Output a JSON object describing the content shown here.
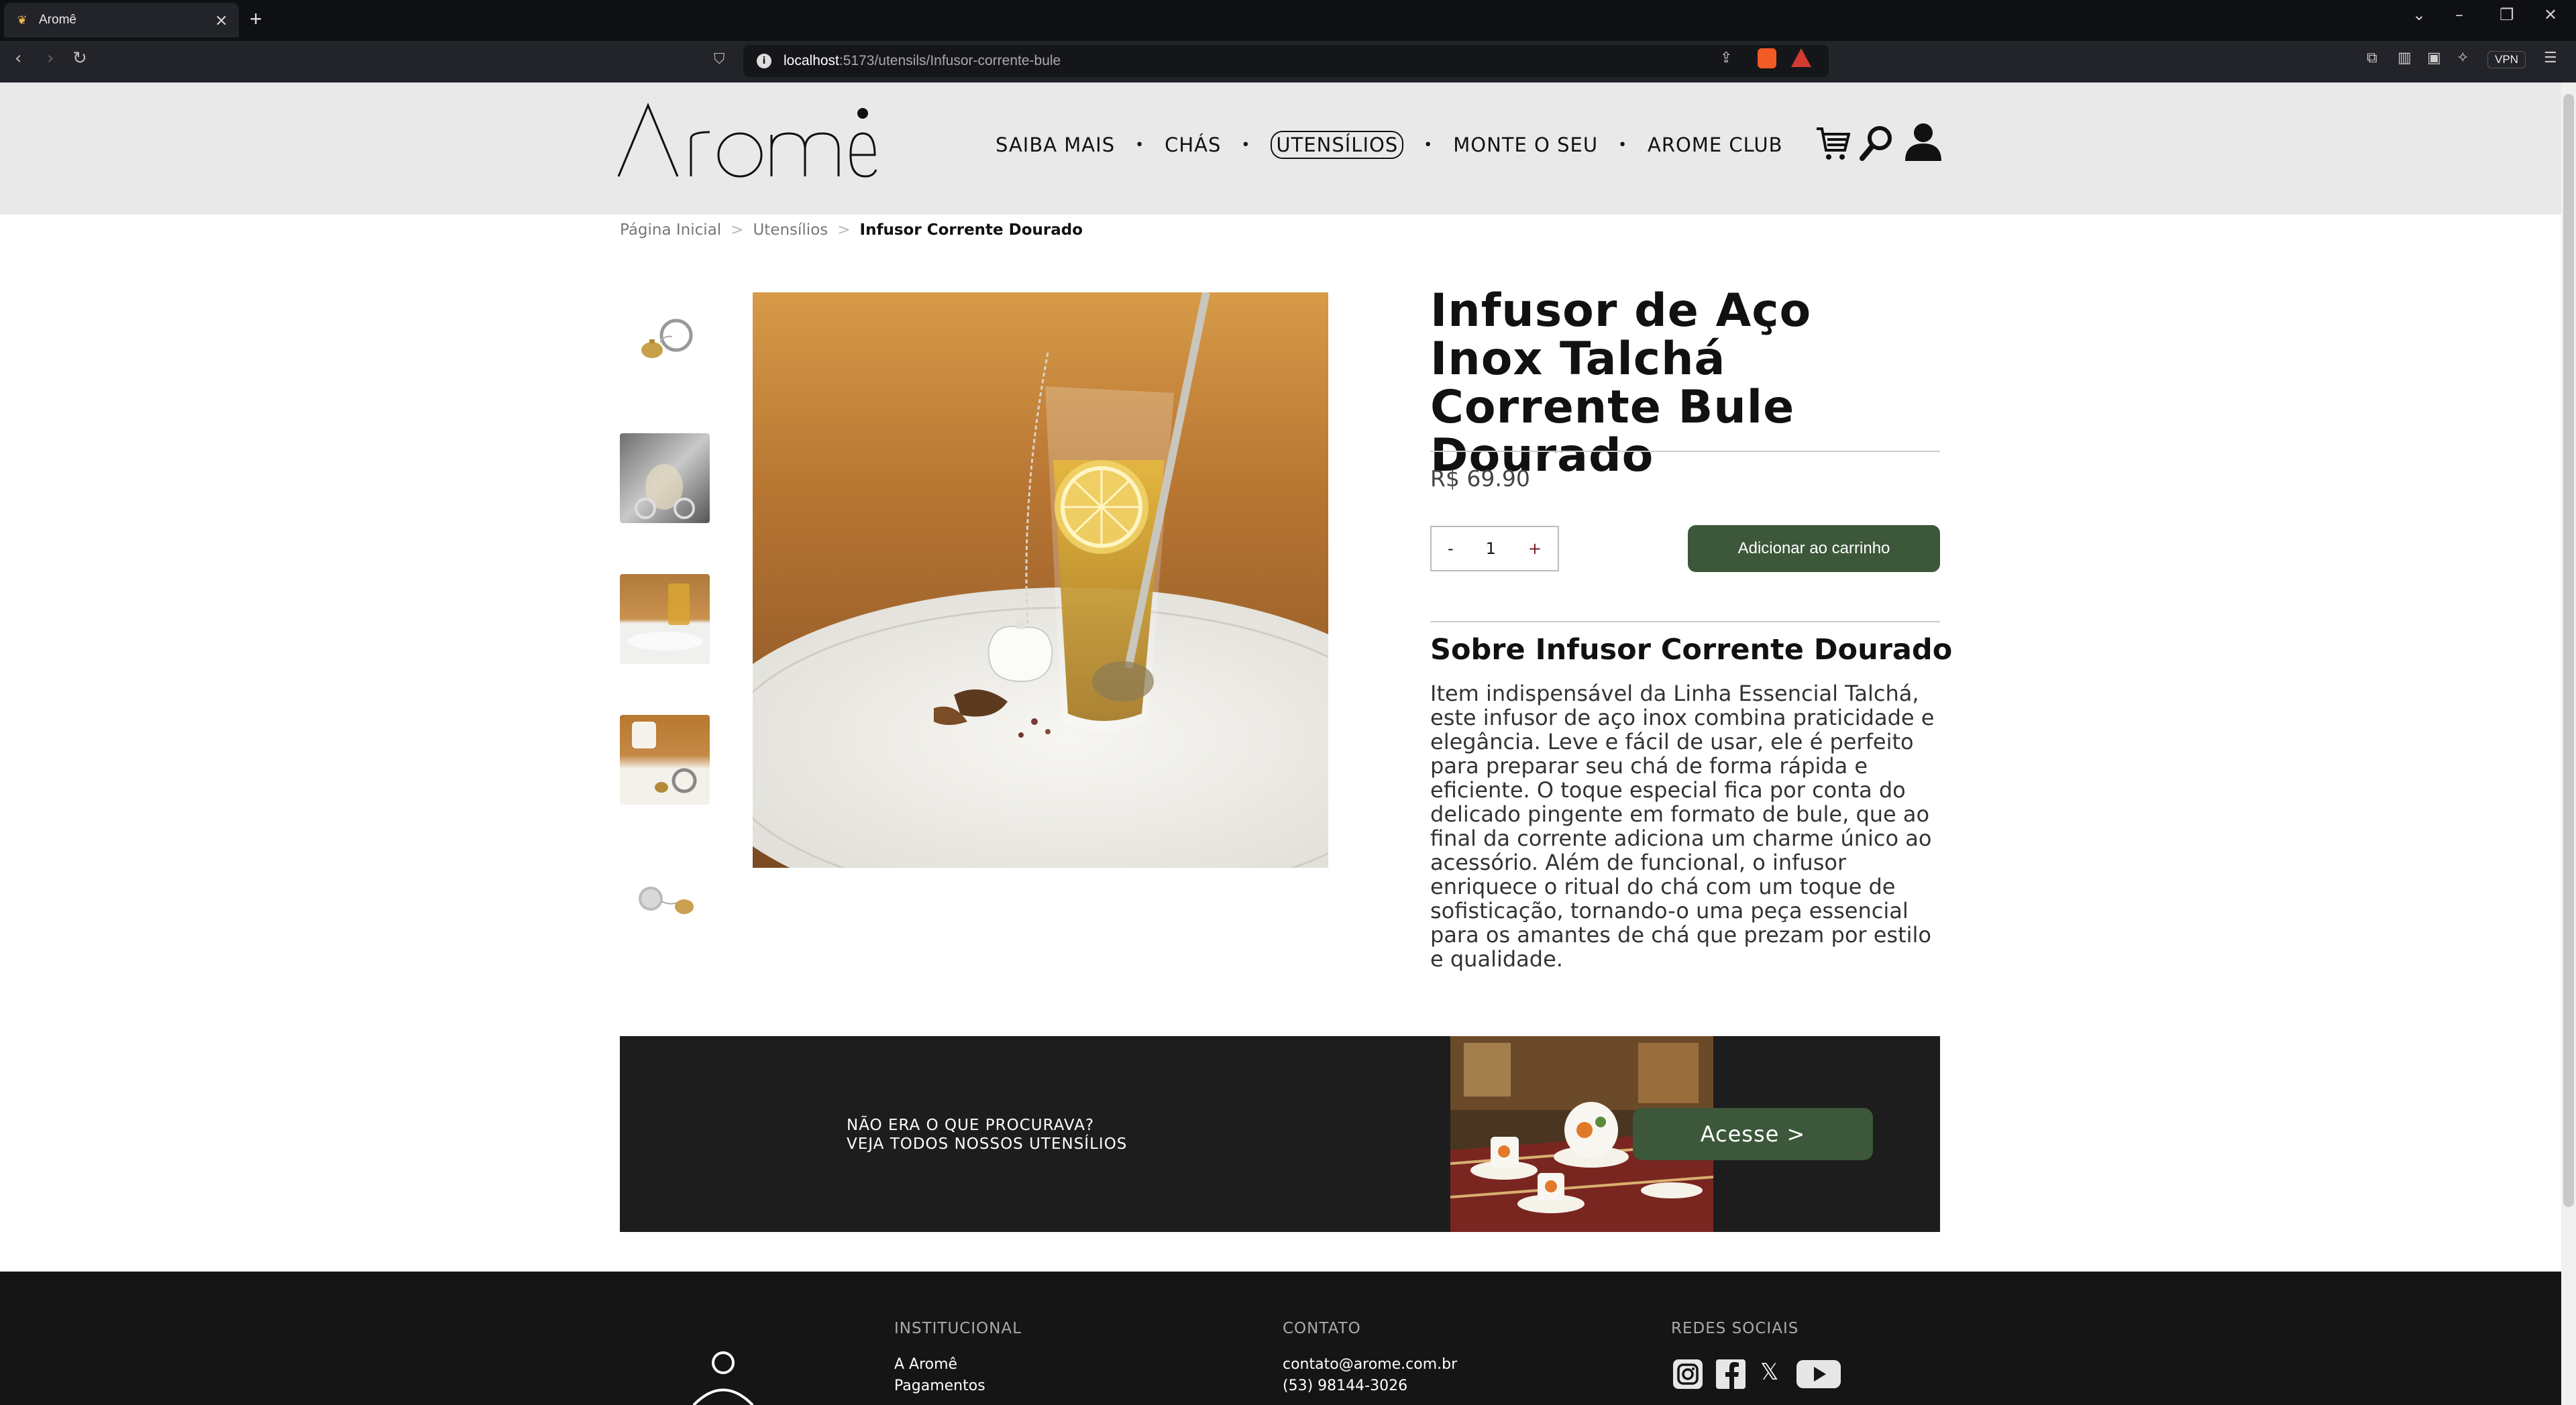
{
  "browser": {
    "tab_title": "Aromê",
    "url_host": "localhost",
    "url_path": ":5173/utensils/Infusor-corrente-bule",
    "vpn_label": "VPN"
  },
  "header": {
    "logo_text": "Aromê",
    "nav": [
      {
        "label": "SAIBA MAIS"
      },
      {
        "label": "CHÁS"
      },
      {
        "label": "UTENSÍLIOS"
      },
      {
        "label": "MONTE O SEU"
      },
      {
        "label": "AROME CLUB"
      }
    ],
    "icons": [
      "cart-icon",
      "search-icon",
      "user-icon"
    ]
  },
  "breadcrumb": [
    "Página Inicial",
    "Utensílios",
    "Infusor Corrente Dourado"
  ],
  "product": {
    "title": "Infusor de Aço Inox Talchá Corrente Bule Dourado",
    "price": "R$ 69.90",
    "qty_minus": "-",
    "qty_value": "1",
    "qty_plus": "+",
    "add_to_cart": "Adicionar ao carrinho",
    "about_title": "Sobre Infusor Corrente Dourado",
    "description": "Item indispensável da Linha Essencial Talchá, este infusor de aço inox combina praticidade e elegância. Leve e fácil de usar, ele é perfeito para preparar seu chá de forma rápida e eficiente. O toque especial fica por conta do delicado pingente em formato de bule, que ao final da corrente adiciona um charme único ao acessório. Além de funcional, o infusor enriquece o ritual do chá com um toque de sofisticação, tornando-o uma peça essencial para os amantes de chá que prezam por estilo e qualidade."
  },
  "banner": {
    "line1": "NÃO ERA O QUE PROCURAVA?",
    "line2": "VEJA TODOS NOSSOS UTENSÍLIOS",
    "button": "Acesse >"
  },
  "footer": {
    "institucional_head": "INSTITUCIONAL",
    "institucional_items": [
      "A Aromê",
      "Pagamentos"
    ],
    "contato_head": "CONTATO",
    "email": "contato@arome.com.br",
    "phone": "(53) 98144-3026",
    "redes_head": "REDES SOCIAIS"
  },
  "colors": {
    "accent_green": "#3c573a",
    "header_bg": "#e9e9e9",
    "banner_bg": "#1d1d1d",
    "footer_bg": "#151515"
  }
}
